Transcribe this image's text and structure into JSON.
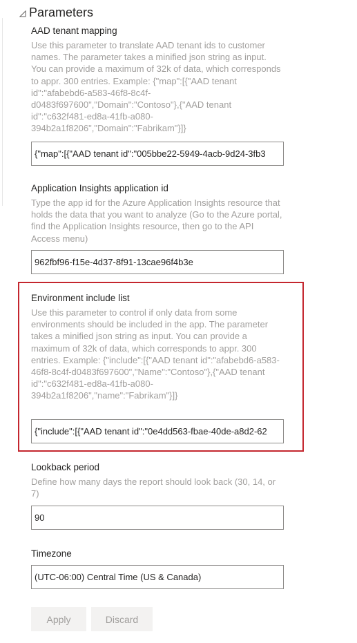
{
  "header": {
    "title": "Parameters"
  },
  "aad_mapping": {
    "label": "AAD tenant mapping",
    "description": "Use this parameter to translate AAD tenant ids to customer names. The parameter takes a minified json string as input. You can provide a maximum of 32k of data, which corresponds to appr. 300 entries. Example: {\"map\":[{\"AAD tenant id\":\"afabebd6-a583-46f8-8c4f-d0483f697600\",\"Domain\":\"Contoso\"},{\"AAD tenant id\":\"c632f481-ed8a-41fb-a080-394b2a1f8206\",\"Domain\":\"Fabrikam\"}]}",
    "value": "{\"map\":[{\"AAD tenant id\":\"005bbe22-5949-4acb-9d24-3fb3"
  },
  "app_insights": {
    "label": "Application Insights application id",
    "description": "Type the app id for the Azure Application Insights resource that holds the data that you want to analyze (Go to the Azure portal, find the Application Insights resource, then go to the API Access menu)",
    "value": "962fbf96-f15e-4d37-8f91-13cae96f4b3e"
  },
  "env_include": {
    "label": "Environment include list",
    "description": "Use this parameter to control if only data from some environments should be included in the app. The parameter takes a minified json string as input. You can provide a maximum of 32k of data, which corresponds to appr. 300 entries. Example: {\"include\":[{\"AAD tenant id\":\"afabebd6-a583-46f8-8c4f-d0483f697600\",\"Name\":\"Contoso\"},{\"AAD tenant id\":\"c632f481-ed8a-41fb-a080-394b2a1f8206\",\"name\":\"Fabrikam\"}]}",
    "value": "{\"include\":[{\"AAD tenant id\":\"0e4dd563-fbae-40de-a8d2-62"
  },
  "lookback": {
    "label": "Lookback period",
    "description": "Define how many days the report should look back (30, 14, or 7)",
    "value": "90"
  },
  "timezone": {
    "label": "Timezone",
    "value": "(UTC-06:00) Central Time (US & Canada)"
  },
  "buttons": {
    "apply_label": "Apply",
    "discard_label": "Discard"
  },
  "colors": {
    "highlight_border": "#c4262e",
    "description_text": "#a19f9d",
    "label_text": "#252423",
    "input_border": "#8a8886",
    "button_background": "#f3f2f1"
  }
}
